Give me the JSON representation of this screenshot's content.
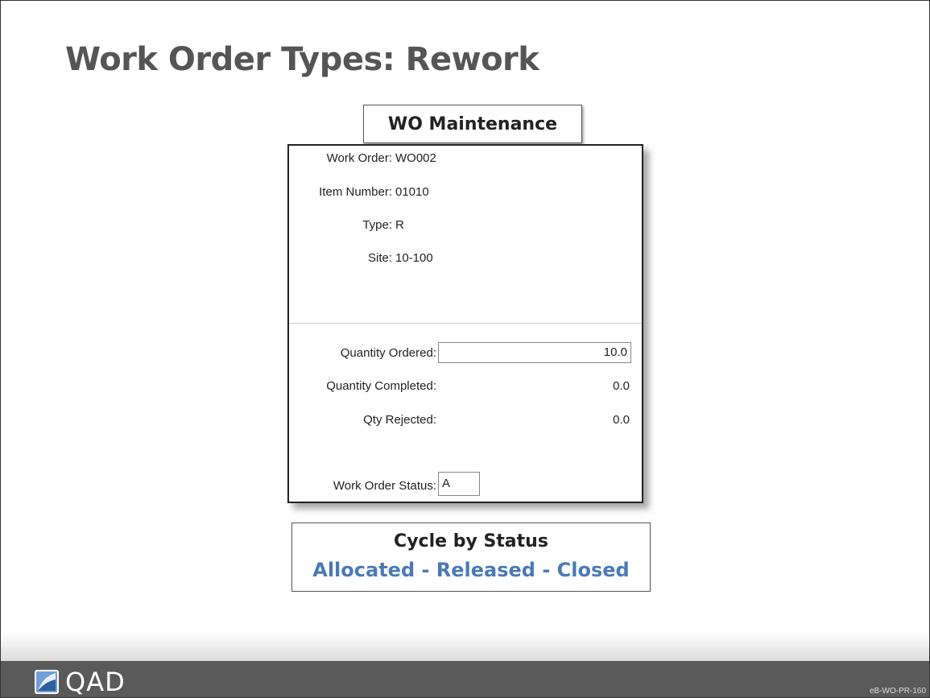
{
  "slide": {
    "title": "Work Order Types: Rework",
    "caption": "WO Maintenance",
    "code": "eB-WO-PR-160"
  },
  "form": {
    "work_order_label": "Work Order:",
    "work_order_value": "WO002",
    "item_number_label": "Item Number:",
    "item_number_value": "01010",
    "type_label": "Type:",
    "type_value": "R",
    "site_label": "Site:",
    "site_value": "10-100",
    "qty_ordered_label": "Quantity Ordered:",
    "qty_ordered_value": "10.0",
    "qty_completed_label": "Quantity Completed:",
    "qty_completed_value": "0.0",
    "qty_rejected_label": "Qty Rejected:",
    "qty_rejected_value": "0.0",
    "status_label": "Work Order Status:",
    "status_value": "A"
  },
  "cycle": {
    "title": "Cycle by Status",
    "states": "Allocated - Released - Closed"
  },
  "footer": {
    "logo_text": "QAD"
  },
  "colors": {
    "title": "#555555",
    "accent_blue": "#4a7ab5",
    "footer_bg": "#5a5a5a"
  }
}
